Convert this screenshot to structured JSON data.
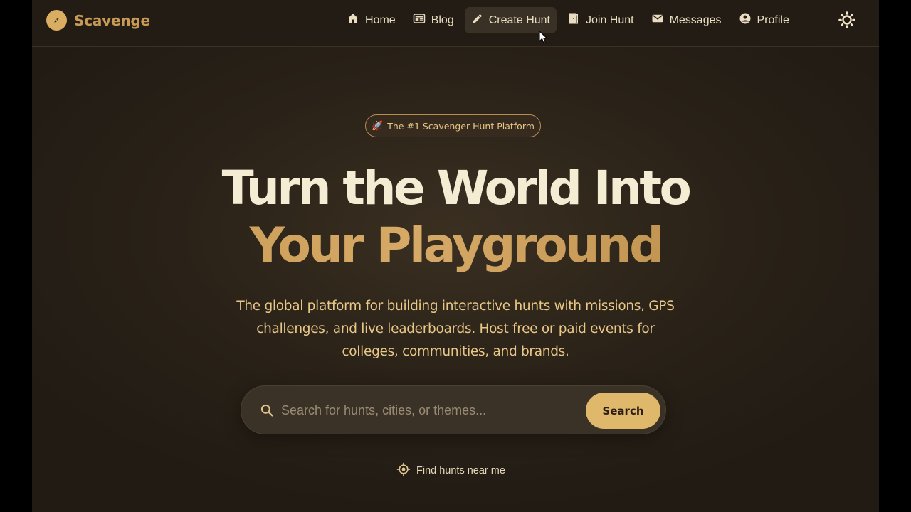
{
  "brand": {
    "name": "Scavenge",
    "logo_icon": "compass-icon",
    "accent": "#d9ad62"
  },
  "nav": {
    "items": [
      {
        "label": "Home",
        "icon": "home-icon"
      },
      {
        "label": "Blog",
        "icon": "newspaper-icon"
      },
      {
        "label": "Create Hunt",
        "icon": "pencil-icon",
        "active": true
      },
      {
        "label": "Join Hunt",
        "icon": "door-icon"
      },
      {
        "label": "Messages",
        "icon": "mail-icon"
      },
      {
        "label": "Profile",
        "icon": "user-circle-icon"
      }
    ],
    "theme_toggle_icon": "sun-icon"
  },
  "hero": {
    "badge": {
      "icon": "🚀",
      "text": "The #1 Scavenger Hunt Platform"
    },
    "headline_line1": "Turn the World Into",
    "headline_line2": "Your Playground",
    "subtitle": "The global platform for building interactive hunts with missions, GPS challenges, and live leaderboards. Host free or paid events for colleges, communities, and brands."
  },
  "search": {
    "placeholder": "Search for hunts, cities, or themes...",
    "value": "",
    "button_label": "Search"
  },
  "near_me": {
    "label": "Find hunts near me",
    "icon": "location-target-icon"
  },
  "colors": {
    "background": "#2a2218",
    "navbar": "#221c15",
    "heading": "#f5ecd4",
    "gold": "#c89b57",
    "button": "#e0b86c"
  }
}
